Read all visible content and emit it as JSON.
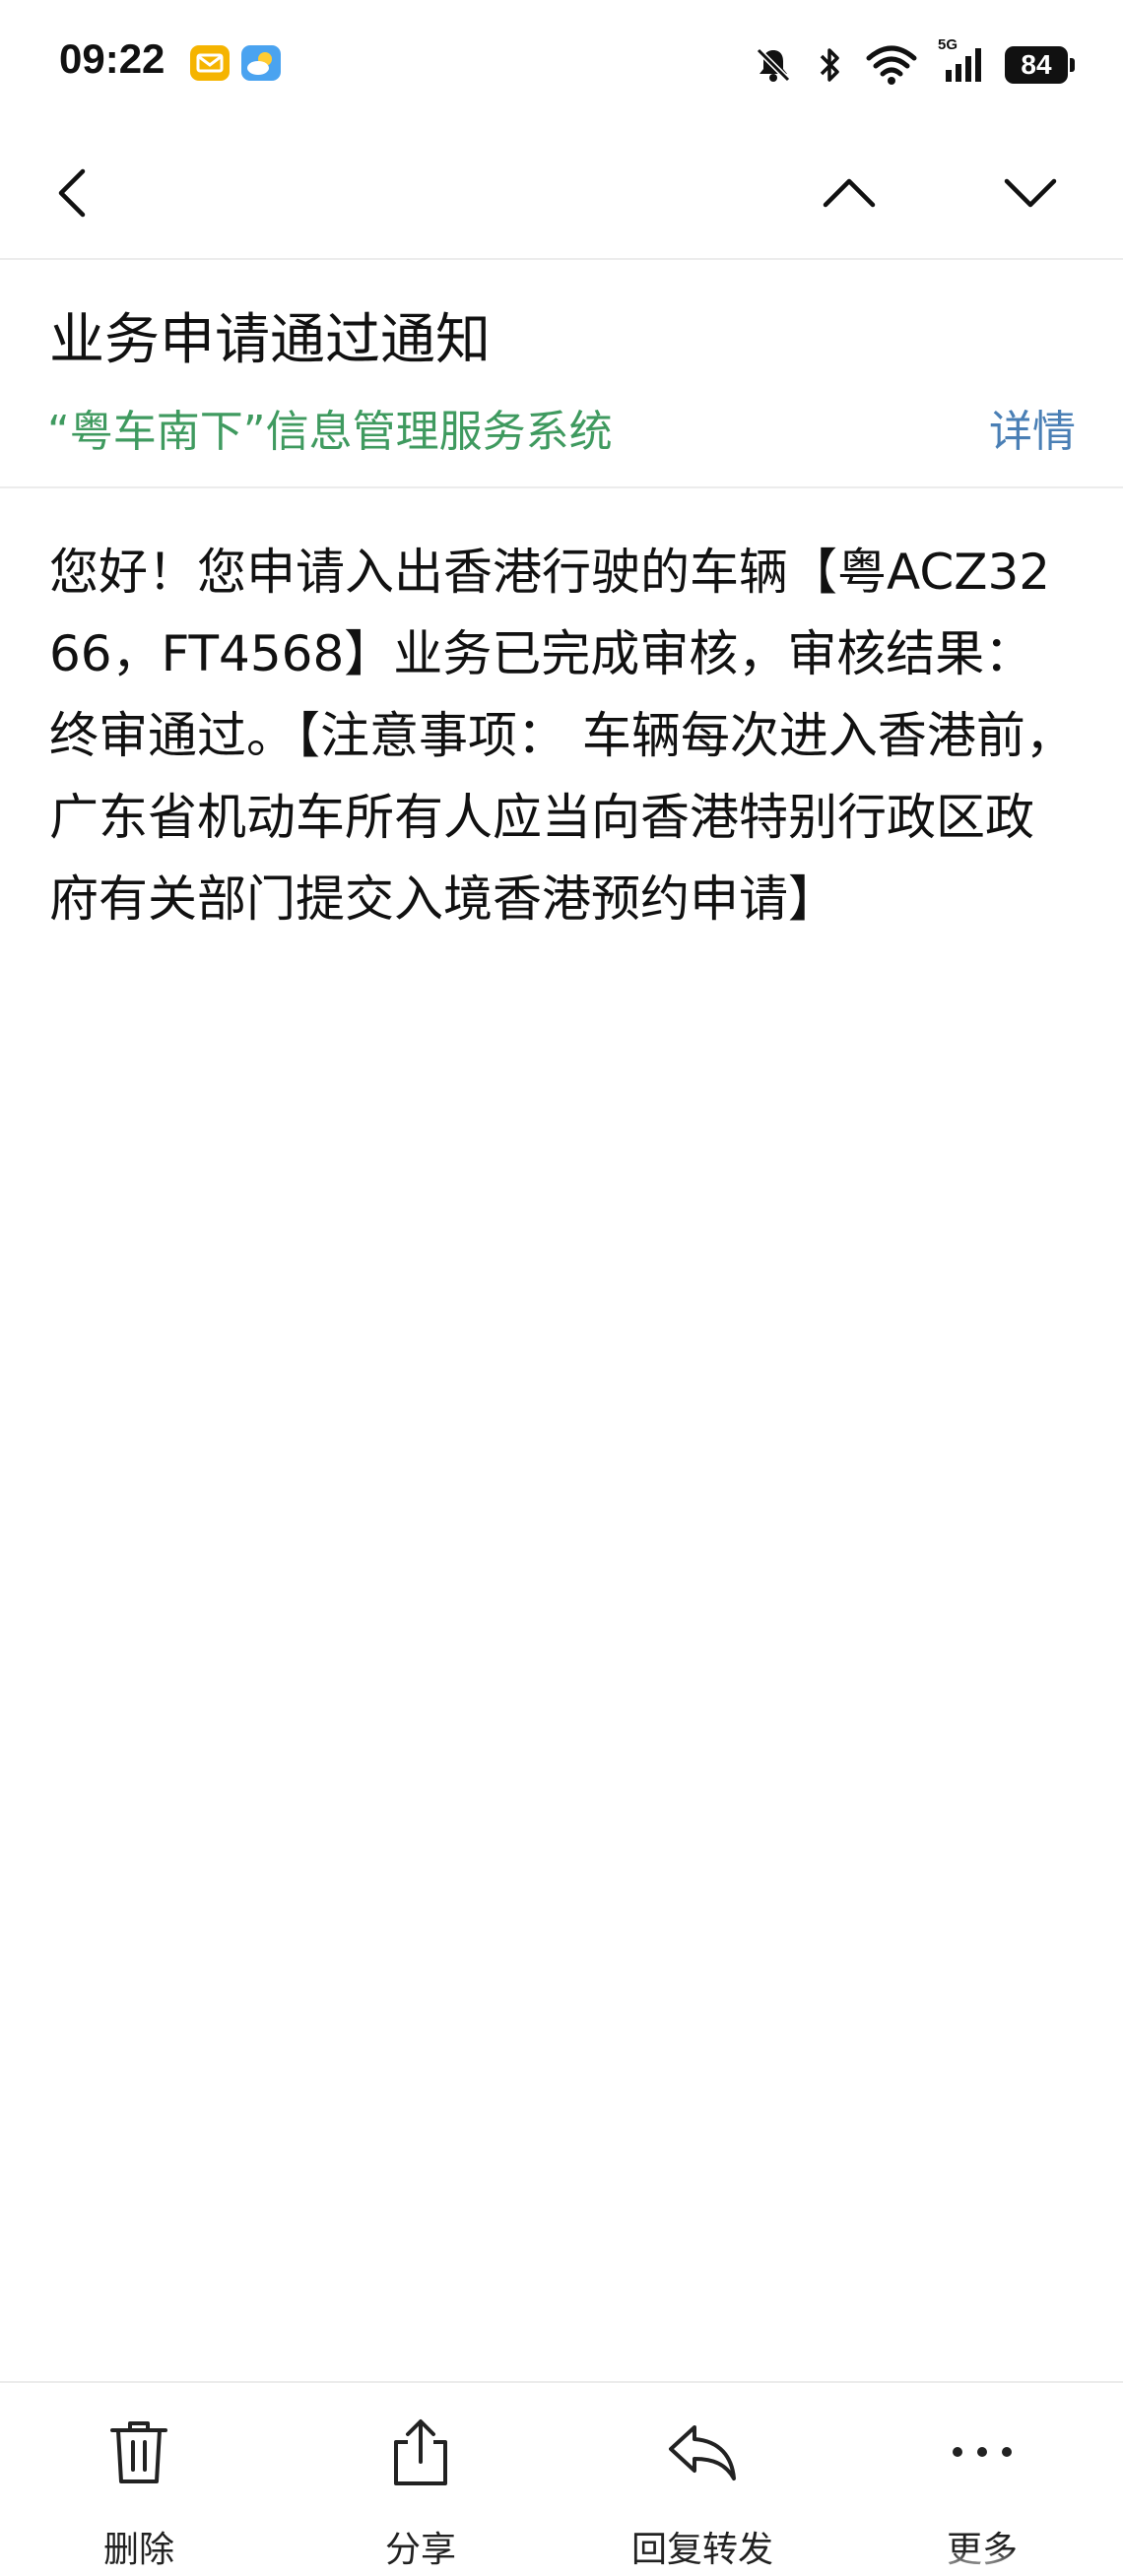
{
  "status_bar": {
    "time": "09:22",
    "network_label": "5G",
    "battery": "84",
    "icons": [
      "mail-notification-icon",
      "weather-notification-icon",
      "mute-icon",
      "bluetooth-icon",
      "wifi-icon",
      "signal-icon",
      "battery-icon"
    ],
    "colors": {
      "mail": "#f5b400",
      "weather": "#4aa3f0"
    }
  },
  "nav": {
    "back_icon": "chevron-left-icon",
    "prev_icon": "chevron-up-icon",
    "next_icon": "chevron-down-icon"
  },
  "message": {
    "subject": "业务申请通过通知",
    "sender": "“粤车南下”信息管理服务系统",
    "details_label": "详情",
    "body": "您好！您申请入出香港行驶的车辆【粤ACZ3266，FT4568】业务已完成审核，审核结果：终审通过。【注意事项： 车辆每次进入香港前，广东省机动车所有人应当向香港特别行政区政府有关部门提交入境香港预约申请】"
  },
  "colors": {
    "sender": "#3f9a5f",
    "link": "#4a7fb5"
  },
  "toolbar": {
    "delete_label": "删除",
    "share_label": "分享",
    "reply_forward_label": "回复转发",
    "more_label": "更多"
  }
}
